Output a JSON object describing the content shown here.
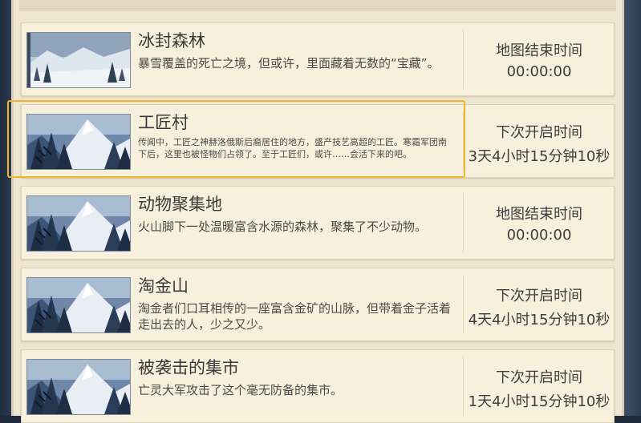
{
  "maps": [
    {
      "name": "冰封森林",
      "description": "暴雪覆盖的死亡之境，但或许，里面藏着无数的“宝藏”。",
      "status_label": "地图结束时间",
      "status_value": "00:00:00",
      "thumbnail_icon": "snowy-forest-thumbnail"
    },
    {
      "name": "工匠村",
      "description": "传闻中，工匠之神赫洛俄斯后裔居住的地方，盛产技艺高超的工匠。寒霜军团南下后，这里也被怪物们占领了。至于工匠们，或许……会活下来的吧。",
      "status_label": "下次开启时间",
      "status_value": "3天4小时15分钟10秒",
      "thumbnail_icon": "mountain-forest-thumbnail"
    },
    {
      "name": "动物聚集地",
      "description": "火山脚下一处温暖富含水源的森林，聚集了不少动物。",
      "status_label": "地图结束时间",
      "status_value": "00:00:00",
      "thumbnail_icon": "mountain-forest-thumbnail"
    },
    {
      "name": "淘金山",
      "description": "淘金者们口耳相传的一座富含金矿的山脉，但带着金子活着走出去的人，少之又少。",
      "status_label": "下次开启时间",
      "status_value": "4天4小时15分钟10秒",
      "thumbnail_icon": "mountain-forest-thumbnail"
    },
    {
      "name": "被袭击的集市",
      "description": "亡灵大军攻击了这个毫无防备的集市。",
      "status_label": "下次开启时间",
      "status_value": "1天4小时15分钟10秒",
      "thumbnail_icon": "mountain-forest-thumbnail"
    }
  ],
  "selected_index": 1,
  "colors": {
    "highlight": "#f2b52a",
    "card_bg": "#f7f0dd",
    "panel_bg": "#efe6d1"
  }
}
